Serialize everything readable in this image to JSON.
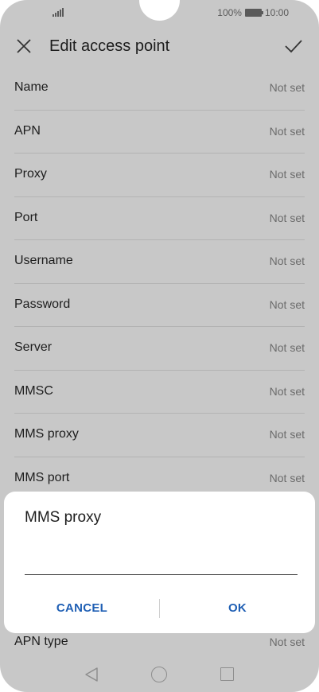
{
  "status_bar": {
    "battery_percent": "100%",
    "time": "10:00"
  },
  "header": {
    "title": "Edit access point"
  },
  "fields": [
    {
      "label": "Name",
      "value": "Not set"
    },
    {
      "label": "APN",
      "value": "Not set"
    },
    {
      "label": "Proxy",
      "value": "Not set"
    },
    {
      "label": "Port",
      "value": "Not set"
    },
    {
      "label": "Username",
      "value": "Not set"
    },
    {
      "label": "Password",
      "value": "Not set"
    },
    {
      "label": "Server",
      "value": "Not set"
    },
    {
      "label": "MMSC",
      "value": "Not set"
    },
    {
      "label": "MMS proxy",
      "value": "Not set"
    },
    {
      "label": "MMS port",
      "value": "Not set"
    }
  ],
  "apn_type": {
    "label": "APN type",
    "value": "Not set"
  },
  "dialog": {
    "title": "MMS proxy",
    "input_value": "",
    "cancel_label": "CANCEL",
    "ok_label": "OK"
  },
  "colors": {
    "accent": "#1f5fb4",
    "background": "#c8c8c8",
    "dialog": "#ffffff"
  }
}
